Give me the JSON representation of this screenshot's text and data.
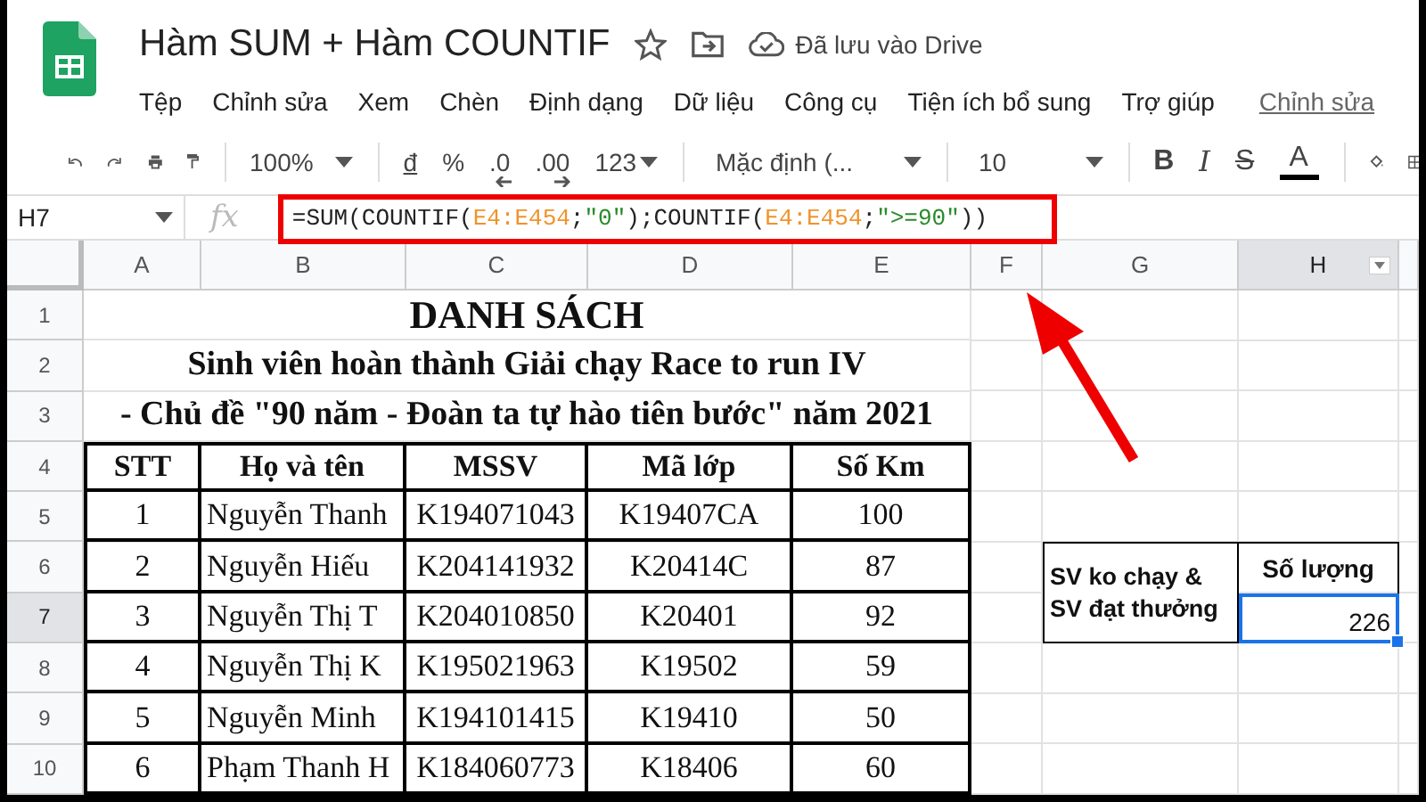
{
  "doc": {
    "title": "Hàm SUM + Hàm COUNTIF",
    "save_status": "Đã lưu vào Drive"
  },
  "menu": [
    "Tệp",
    "Chỉnh sửa",
    "Xem",
    "Chèn",
    "Định dạng",
    "Dữ liệu",
    "Công cụ",
    "Tiện ích bổ sung",
    "Trợ giúp"
  ],
  "menu_link": "Chỉnh sửa",
  "toolbar": {
    "zoom": "100%",
    "currency": "đ",
    "percent": "%",
    "decrease_decimals": ".0",
    "increase_decimals": ".00",
    "number_format": "123",
    "font": "Mặc định (...",
    "font_size": "10",
    "bold": "B",
    "italic": "I",
    "strikethrough": "S",
    "text_color": "A"
  },
  "formula_bar": {
    "cell": "H7",
    "fx": "fx",
    "formula": [
      {
        "kind": "plain",
        "text": "=SUM(COUNTIF("
      },
      {
        "kind": "ref",
        "text": "E4:E454"
      },
      {
        "kind": "plain",
        "text": ";"
      },
      {
        "kind": "string",
        "text": "\"0\""
      },
      {
        "kind": "plain",
        "text": ");COUNTIF("
      },
      {
        "kind": "ref",
        "text": "E4:E454"
      },
      {
        "kind": "plain",
        "text": ";"
      },
      {
        "kind": "string",
        "text": "\">=90\""
      },
      {
        "kind": "plain",
        "text": "))"
      }
    ]
  },
  "columns": [
    {
      "label": "A",
      "selected": false
    },
    {
      "label": "B",
      "selected": false
    },
    {
      "label": "C",
      "selected": false
    },
    {
      "label": "D",
      "selected": false
    },
    {
      "label": "E",
      "selected": false
    },
    {
      "label": "F",
      "selected": false
    },
    {
      "label": "G",
      "selected": false
    },
    {
      "label": "H",
      "selected": true
    }
  ],
  "rows": [
    {
      "label": "1",
      "selected": false
    },
    {
      "label": "2",
      "selected": false
    },
    {
      "label": "3",
      "selected": false
    },
    {
      "label": "4",
      "selected": false
    },
    {
      "label": "5",
      "selected": false
    },
    {
      "label": "6",
      "selected": false
    },
    {
      "label": "7",
      "selected": true
    },
    {
      "label": "8",
      "selected": false
    },
    {
      "label": "9",
      "selected": false
    },
    {
      "label": "10",
      "selected": false
    }
  ],
  "sheet": {
    "title": "DANH SÁCH",
    "subtitle": "Sinh viên hoàn thành Giải chạy Race to run IV",
    "theme": "- Chủ đề \"90 năm - Đoàn ta tự hào tiên bước\" năm 2021",
    "headers": [
      "STT",
      "Họ và tên",
      "MSSV",
      "Mã lớp",
      "Số Km"
    ],
    "records": [
      [
        "1",
        "Nguyễn Thanh",
        "K194071043",
        "K19407CA",
        "100"
      ],
      [
        "2",
        "Nguyễn Hiếu",
        "K204141932",
        "K20414C",
        "87"
      ],
      [
        "3",
        "Nguyễn Thị T",
        "K204010850",
        "K20401",
        "92"
      ],
      [
        "4",
        "Nguyễn Thị K",
        "K195021963",
        "K19502",
        "59"
      ],
      [
        "5",
        "Nguyễn Minh",
        "K194101415",
        "K19410",
        "50"
      ],
      [
        "6",
        "Phạm Thanh H",
        "K184060773",
        "K18406",
        "60"
      ]
    ],
    "summary": {
      "label": "SV ko chạy & SV đạt thưởng",
      "header": "Số lượng",
      "value": "226"
    }
  }
}
